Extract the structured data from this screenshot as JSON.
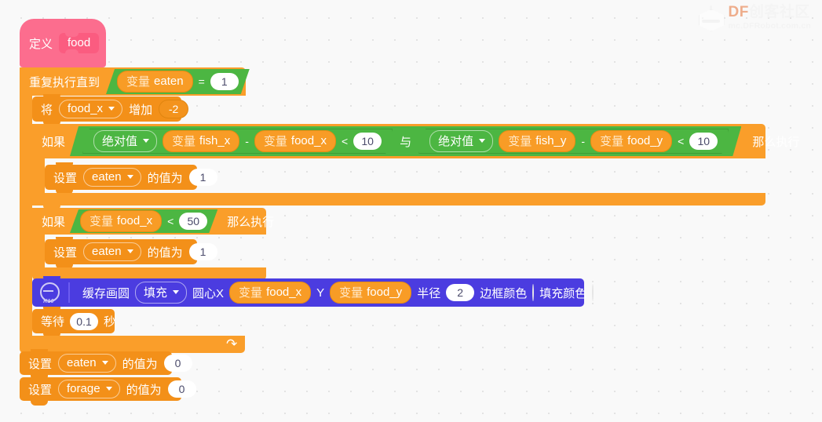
{
  "watermark": {
    "brand_df": "DF",
    "brand_cn": "创客社区",
    "url": "mc.DFRobot.com.cn",
    "logo_icon": "robot-hexagon-icon"
  },
  "colors": {
    "canvas": "#f9f9f9",
    "grid_dot": "#e3e3e3",
    "control_orange": "#fa9e2a",
    "variable_orange": "#f89c26",
    "operator_green": "#4cb642",
    "define_pink": "#fc6d8e",
    "display_purple": "#4b3ce0",
    "accent_df": "#e8804a"
  },
  "blocks": {
    "define": {
      "keyword": "定义",
      "procedure_name": "food"
    },
    "repeat_until": {
      "keyword": "重复执行直到",
      "condition": {
        "left_variable_keyword": "变量",
        "left_variable_name": "eaten",
        "operator": "=",
        "right_value": "1"
      },
      "loop_arrow_icon": "loop-arrow-icon"
    },
    "change_variable": {
      "keyword_prefix": "将",
      "variable_name": "food_x",
      "keyword_suffix": "增加",
      "value": "-2"
    },
    "if_collision": {
      "keyword": "如果",
      "then_keyword": "那么执行",
      "conjunction": "与",
      "cond_x": {
        "function": "绝对值",
        "operand_a_keyword": "变量",
        "operand_a_name": "fish_x",
        "minus": "-",
        "operand_b_keyword": "变量",
        "operand_b_name": "food_x",
        "comparator": "<",
        "threshold": "10"
      },
      "cond_y": {
        "function": "绝对值",
        "operand_a_keyword": "变量",
        "operand_a_name": "fish_y",
        "minus": "-",
        "operand_b_keyword": "变量",
        "operand_b_name": "food_y",
        "comparator": "<",
        "threshold": "10"
      },
      "body": {
        "keyword_prefix": "设置",
        "variable_name": "eaten",
        "keyword_suffix": "的值为",
        "value": "1"
      }
    },
    "if_offscreen": {
      "keyword": "如果",
      "then_keyword": "那么执行",
      "condition": {
        "variable_keyword": "变量",
        "variable_name": "food_x",
        "comparator": "<",
        "value": "50"
      },
      "body": {
        "keyword_prefix": "设置",
        "variable_name": "eaten",
        "keyword_suffix": "的值为",
        "value": "1"
      }
    },
    "draw_circle": {
      "device_icon": "k10-board-icon",
      "keyword": "缓存画圆",
      "mode": "填充",
      "center_x_label": "圆心X",
      "center_x_variable_keyword": "变量",
      "center_x_variable_name": "food_x",
      "center_y_label": "Y",
      "center_y_variable_keyword": "变量",
      "center_y_variable_name": "food_y",
      "radius_label": "半径",
      "radius_value": "2",
      "border_color_label": "边框颜色",
      "border_color": "#ffffff",
      "fill_color_label": "填充颜色",
      "fill_color": "#ffffff"
    },
    "wait": {
      "keyword_prefix": "等待",
      "seconds": "0.1",
      "keyword_suffix": "秒"
    },
    "set_eaten_zero": {
      "keyword_prefix": "设置",
      "variable_name": "eaten",
      "keyword_suffix": "的值为",
      "value": "0"
    },
    "set_forage_zero": {
      "keyword_prefix": "设置",
      "variable_name": "forage",
      "keyword_suffix": "的值为",
      "value": "0"
    }
  }
}
